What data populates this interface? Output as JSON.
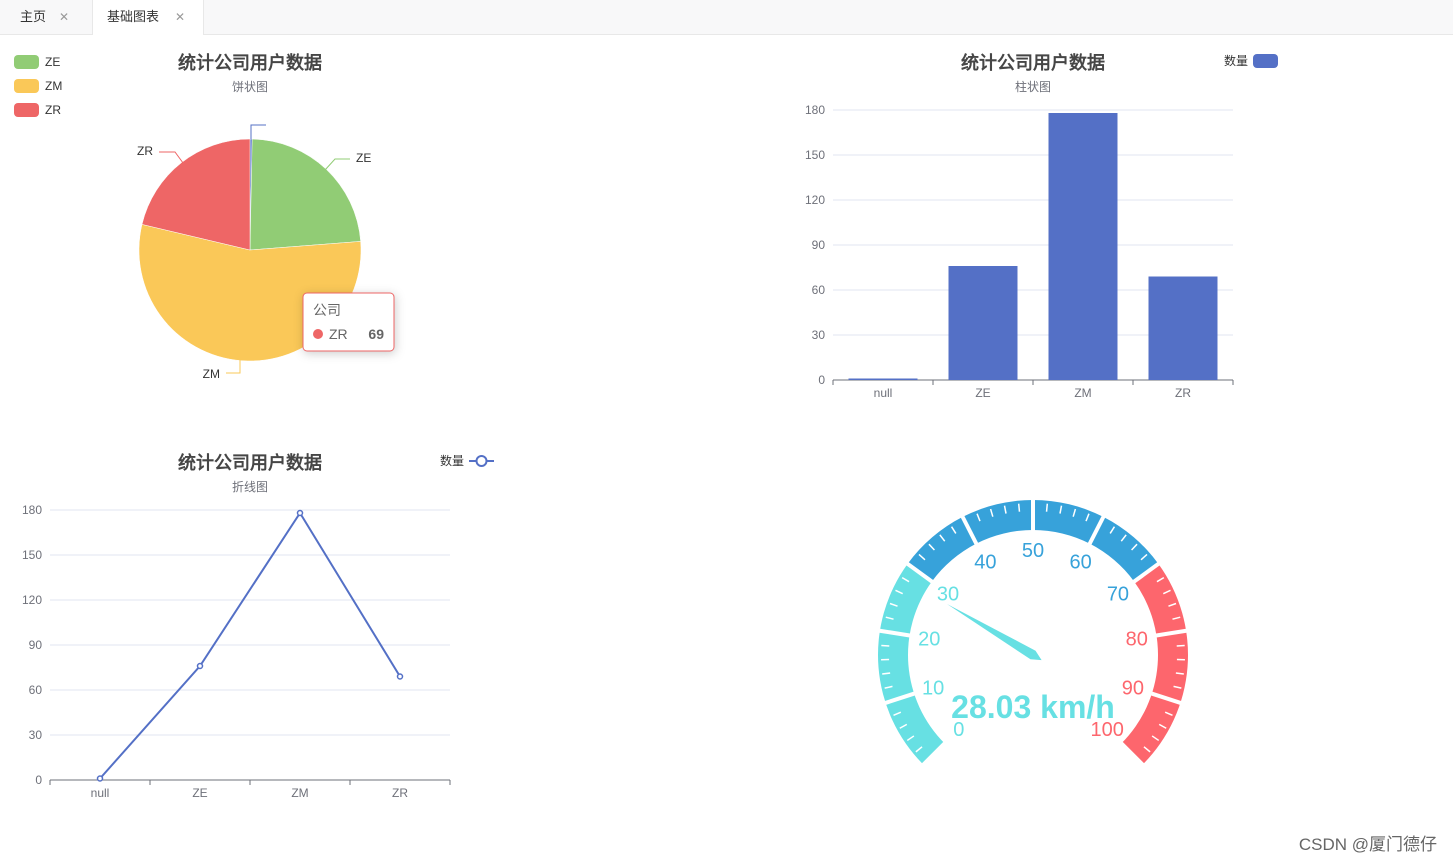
{
  "tabs": [
    {
      "label": "主页",
      "active": false
    },
    {
      "label": "基础图表",
      "active": true
    }
  ],
  "watermark": "CSDN @厦门德仔",
  "colors": {
    "green": "#91cc75",
    "yellow": "#fac858",
    "red": "#ee6666",
    "blue": "#5470c6",
    "gauge_cyan": "#67e0e3",
    "gauge_blue": "#37a2da",
    "gauge_red": "#fd666d"
  },
  "chart_data": [
    {
      "type": "pie",
      "title": "统计公司用户数据",
      "subtitle": "饼状图",
      "legend": [
        "ZE",
        "ZM",
        "ZR"
      ],
      "legend_position": "top-left",
      "slices": [
        {
          "name": "null",
          "value": 1
        },
        {
          "name": "ZE",
          "value": 76
        },
        {
          "name": "ZM",
          "value": 178
        },
        {
          "name": "ZR",
          "value": 69
        }
      ],
      "tooltip": {
        "title": "公司",
        "name": "ZR",
        "value": "69"
      }
    },
    {
      "type": "bar",
      "title": "统计公司用户数据",
      "subtitle": "柱状图",
      "legend": [
        "数量"
      ],
      "legend_position": "top-right",
      "categories": [
        "null",
        "ZE",
        "ZM",
        "ZR"
      ],
      "values": [
        1,
        76,
        178,
        69
      ],
      "ylim": [
        0,
        180
      ],
      "yticks": [
        "0",
        "30",
        "60",
        "90",
        "120",
        "150",
        "180"
      ],
      "grid": true
    },
    {
      "type": "line",
      "title": "统计公司用户数据",
      "subtitle": "折线图",
      "legend": [
        "数量"
      ],
      "legend_position": "top-right",
      "categories": [
        "null",
        "ZE",
        "ZM",
        "ZR"
      ],
      "values": [
        1,
        76,
        178,
        69
      ],
      "ylim": [
        0,
        180
      ],
      "yticks": [
        "0",
        "30",
        "60",
        "90",
        "120",
        "150",
        "180"
      ],
      "grid": true
    },
    {
      "type": "gauge",
      "value": 28.03,
      "min": 0,
      "max": 100,
      "detail": "28.03 km/h",
      "labels": [
        "0",
        "10",
        "20",
        "30",
        "40",
        "50",
        "60",
        "70",
        "80",
        "90",
        "100"
      ],
      "color_bands": [
        {
          "to": 0.3,
          "color": "#67e0e3"
        },
        {
          "to": 0.7,
          "color": "#37a2da"
        },
        {
          "to": 1.0,
          "color": "#fd666d"
        }
      ]
    }
  ]
}
